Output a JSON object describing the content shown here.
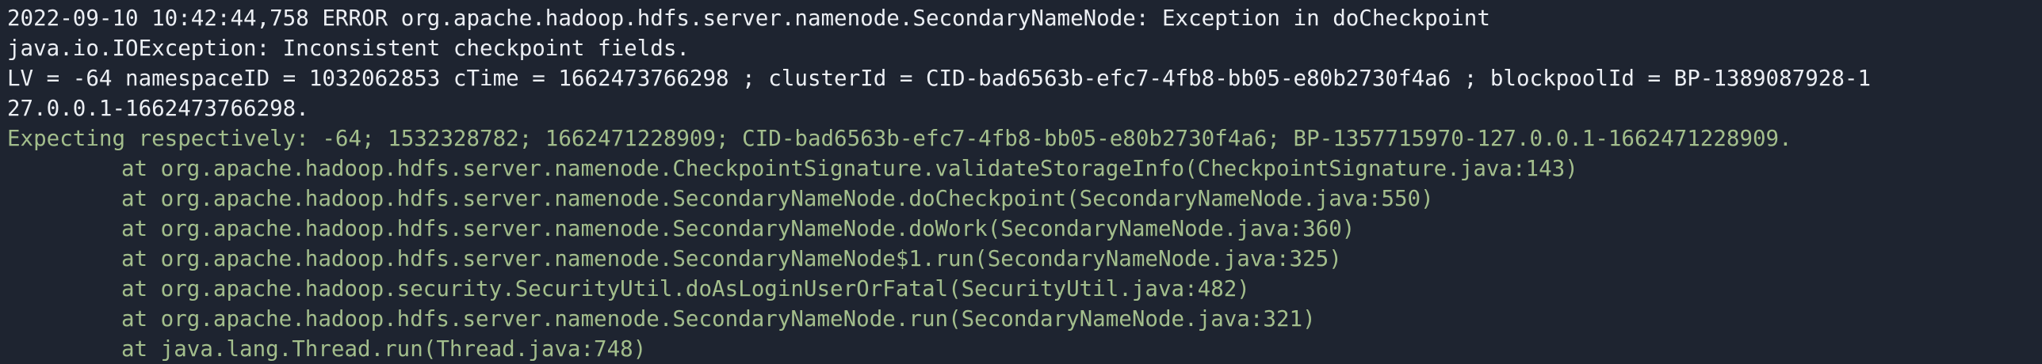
{
  "colors": {
    "background": "#1e2430",
    "foreground": "#eceff4",
    "accent_green": "#a3be8c"
  },
  "log": {
    "header": "2022-09-10 10:42:44,758 ERROR org.apache.hadoop.hdfs.server.namenode.SecondaryNameNode: Exception in doCheckpoint",
    "exception": "java.io.IOException: Inconsistent checkpoint fields.",
    "details_line1": "LV = -64 namespaceID = 1032062853 cTime = 1662473766298 ; clusterId = CID-bad6563b-efc7-4fb8-bb05-e80b2730f4a6 ; blockpoolId = BP-1389087928-1",
    "details_line2": "27.0.0.1-1662473766298.",
    "expecting": "Expecting respectively: -64; 1532328782; 1662471228909; CID-bad6563b-efc7-4fb8-bb05-e80b2730f4a6; BP-1357715970-127.0.0.1-1662471228909.",
    "stack": [
      {
        "at": "at ",
        "method": "org.apache.hadoop.hdfs.server.namenode.CheckpointSignature.validateStorageInfo",
        "location": "(CheckpointSignature.java:143)"
      },
      {
        "at": "at ",
        "method": "org.apache.hadoop.hdfs.server.namenode.SecondaryNameNode.doCheckpoint",
        "location": "(SecondaryNameNode.java:550)"
      },
      {
        "at": "at ",
        "method": "org.apache.hadoop.hdfs.server.namenode.SecondaryNameNode.doWork",
        "location": "(SecondaryNameNode.java:360)"
      },
      {
        "at": "at ",
        "method": "org.apache.hadoop.hdfs.server.namenode.SecondaryNameNode$1.run",
        "location": "(SecondaryNameNode.java:325)"
      },
      {
        "at": "at ",
        "method": "org.apache.hadoop.security.SecurityUtil.doAsLoginUserOrFatal",
        "location": "(SecurityUtil.java:482)"
      },
      {
        "at": "at ",
        "method": "org.apache.hadoop.hdfs.server.namenode.SecondaryNameNode.run",
        "location": "(SecondaryNameNode.java:321)"
      },
      {
        "at": "at ",
        "method": "java.lang.Thread.run",
        "location": "(Thread.java:748)"
      }
    ]
  }
}
